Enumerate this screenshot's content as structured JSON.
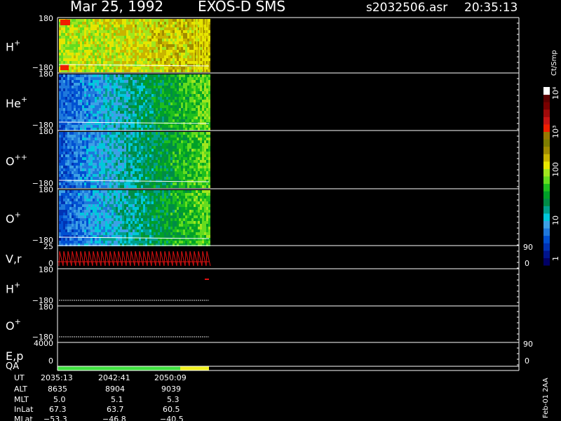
{
  "header": {
    "date": "Mar 25, 1992",
    "instrument": "EXOS-D SMS",
    "file": "s2032506.asr",
    "time": "20:35:13"
  },
  "colorbar": {
    "unit_label": "Ct/Smp",
    "tick_labels": [
      "1",
      "10",
      "100",
      "10³",
      "10⁴"
    ],
    "colors": [
      "#000066",
      "#00148c",
      "#0032b4",
      "#0050d2",
      "#1e78dc",
      "#3ca0e6",
      "#00c8dc",
      "#00a08c",
      "#008c46",
      "#00a028",
      "#1ebe1e",
      "#64dc1e",
      "#a0e61e",
      "#e6e600",
      "#c8b400",
      "#a08c00",
      "#7d7d00",
      "#967800",
      "#f01e00",
      "#c81414",
      "#a00a0a",
      "#780000",
      "#5a0000",
      "#ffffff"
    ],
    "palette_names": [
      "dark-navy",
      "blue",
      "cyan",
      "green",
      "lime",
      "yellow",
      "olive",
      "red",
      "dark-red",
      "white"
    ]
  },
  "panels": [
    {
      "id": "hplus-spec",
      "label": "H",
      "sup": "+",
      "ymax": "180",
      "ymin": "−180",
      "kind": "spectrogram",
      "dominant": "green-yellow"
    },
    {
      "id": "heplus-spec",
      "label": "He",
      "sup": "+",
      "ymax": "180",
      "ymin": "−180",
      "kind": "spectrogram",
      "dominant": "blue-green"
    },
    {
      "id": "oplusplus-spec",
      "label": "O",
      "sup": "++",
      "ymax": "180",
      "ymin": "−180",
      "kind": "spectrogram",
      "dominant": "blue-green"
    },
    {
      "id": "oplus-spec",
      "label": "O",
      "sup": "+",
      "ymax": "180",
      "ymin": "−180",
      "kind": "spectrogram",
      "dominant": "blue-green"
    },
    {
      "id": "vr",
      "label": "V,r",
      "sup": "",
      "ymax": "25",
      "ymin": "0",
      "rmax": "90",
      "rmin": "0",
      "kind": "sawtooth"
    },
    {
      "id": "hplus-line",
      "label": "H",
      "sup": "+",
      "ymax": "180",
      "ymin": "−180",
      "kind": "line"
    },
    {
      "id": "oplus-line",
      "label": "O",
      "sup": "+",
      "ymax": "180",
      "ymin": "−180",
      "kind": "line"
    },
    {
      "id": "ep",
      "label": "E,p",
      "sup": "",
      "ymax": "4000",
      "ymin": "0",
      "rmax": "90",
      "rmin": "0",
      "kind": "empty"
    },
    {
      "id": "qa",
      "label": "QA",
      "sup": "",
      "kind": "bar"
    }
  ],
  "ephemeris": {
    "rows": [
      {
        "label": "UT",
        "values": [
          "2035:13",
          "2042:41",
          "2050:09"
        ]
      },
      {
        "label": "ALT",
        "values": [
          "8635",
          "8904",
          "9039"
        ]
      },
      {
        "label": "MLT",
        "values": [
          "5.0",
          "5.1",
          "5.3"
        ]
      },
      {
        "label": "InLat",
        "values": [
          "67.3",
          "63.7",
          "60.5"
        ]
      },
      {
        "label": "MLat",
        "values": [
          "−53.3",
          "−46.8",
          "−40.5"
        ]
      }
    ]
  },
  "footer": {
    "stamp": "Feb-01 2AA"
  },
  "chart_data": {
    "type": "heatmap",
    "title": "Mar 25, 1992   EXOS-D SMS",
    "time_ticks": [
      "2035:13",
      "2042:41",
      "2050:09"
    ],
    "ylim": [
      -180,
      180
    ],
    "qa_segments": [
      {
        "color": "green",
        "from": "2035:13",
        "to": "2050:09"
      },
      {
        "color": "yellow",
        "from": "2050:09",
        "to": "end"
      }
    ]
  }
}
